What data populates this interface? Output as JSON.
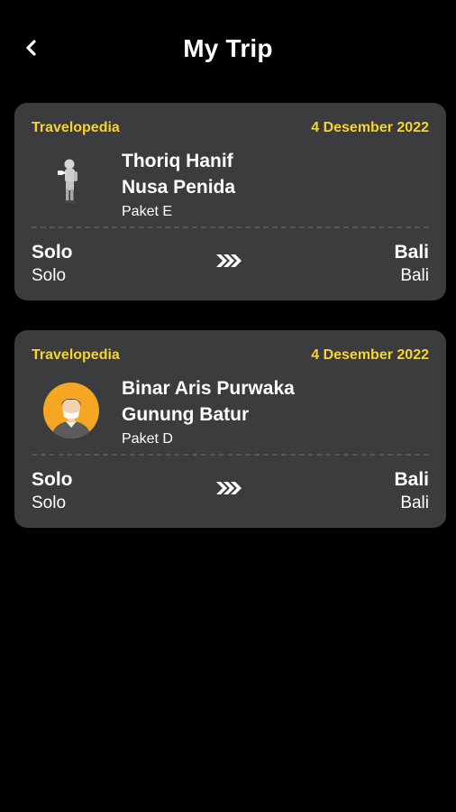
{
  "header": {
    "title": "My Trip",
    "back_icon": "chevron-left-icon"
  },
  "colors": {
    "background": "#000000",
    "card": "#3c3c3e",
    "accent": "#f7d32b",
    "text": "#ffffff"
  },
  "trips": [
    {
      "agency": "Travelopedia",
      "date": "4 Desember 2022",
      "traveler": "Thoriq Hanif",
      "destination": "Nusa Penida",
      "package": "Paket E",
      "avatar_icon": "person-standing-avatar",
      "from_city": "Solo",
      "from_sub": "Solo",
      "to_city": "Bali",
      "to_sub": "Bali",
      "arrow_icon": "triple-chevron-right-icon"
    },
    {
      "agency": "Travelopedia",
      "date": "4 Desember 2022",
      "traveler": "Binar Aris Purwaka",
      "destination": "Gunung Batur",
      "package": "Paket D",
      "avatar_icon": "person-circle-avatar",
      "from_city": "Solo",
      "from_sub": "Solo",
      "to_city": "Bali",
      "to_sub": "Bali",
      "arrow_icon": "triple-chevron-right-icon"
    }
  ]
}
